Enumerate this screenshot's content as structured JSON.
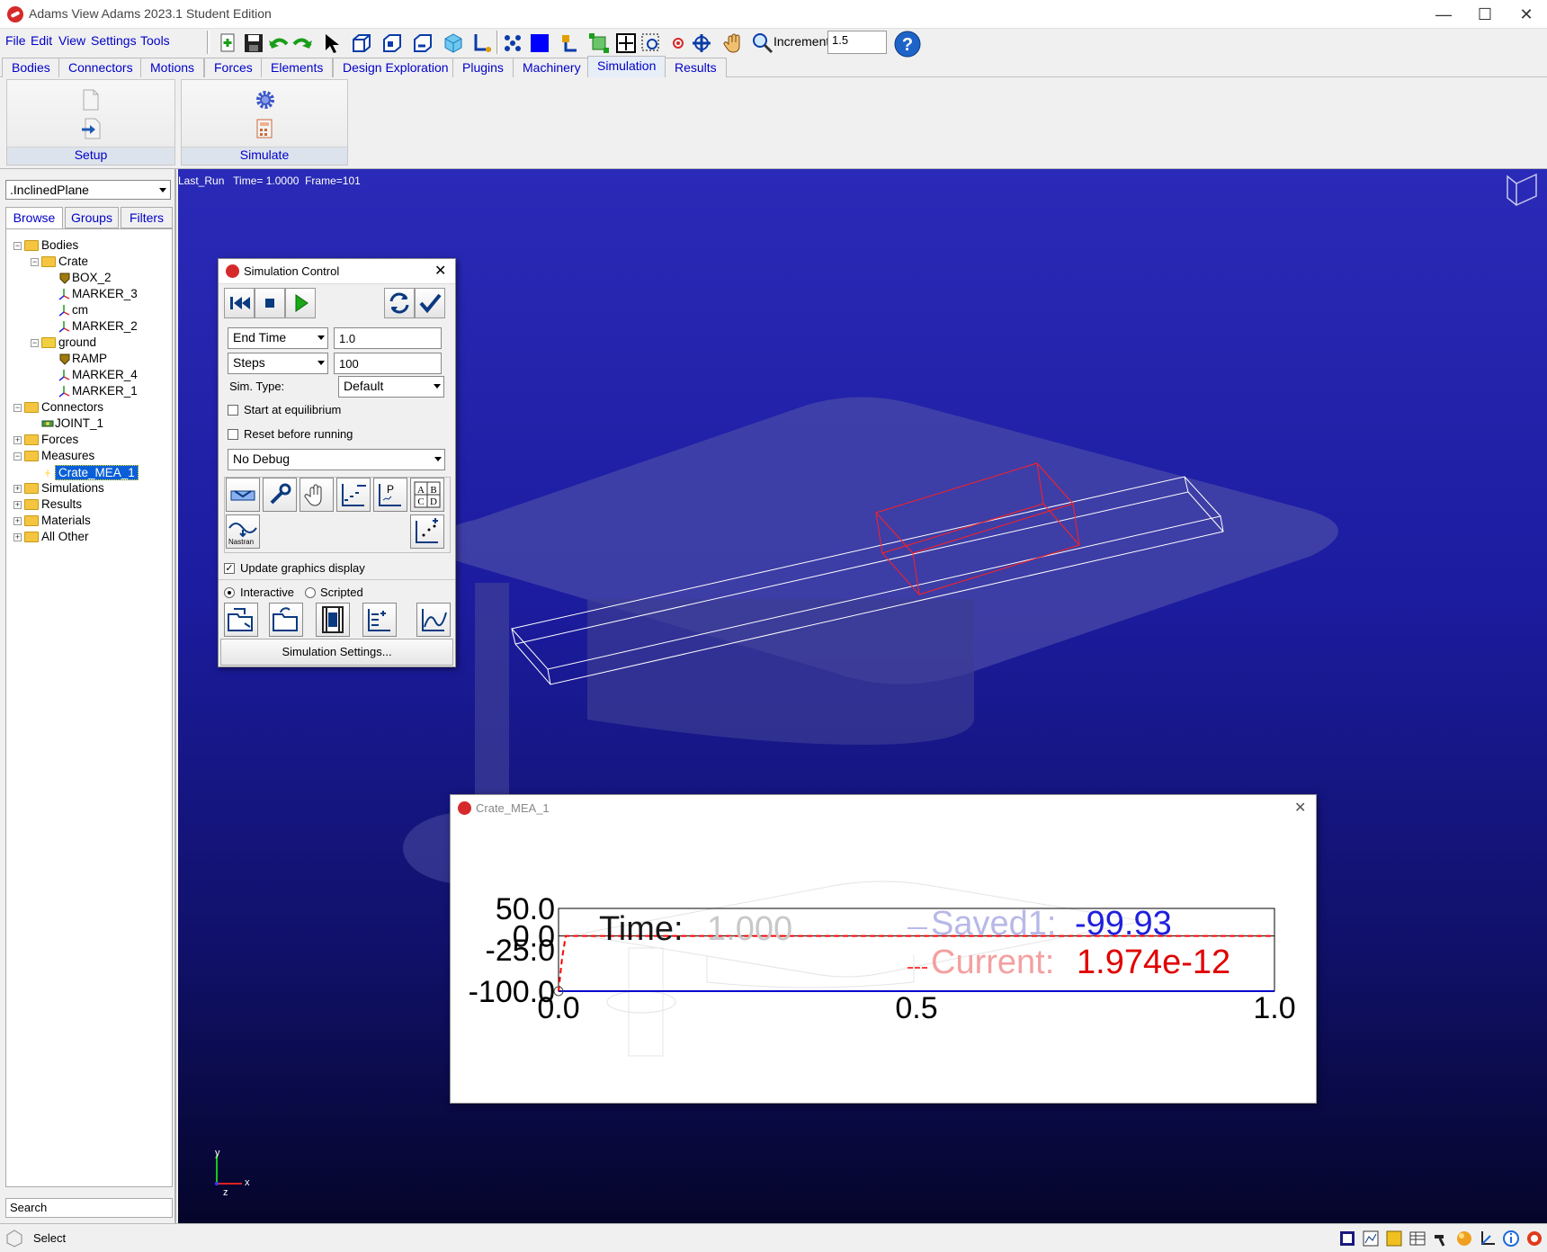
{
  "window": {
    "title": "Adams  View Adams 2023.1 Student Edition",
    "controls": [
      "—",
      "☐",
      "✕"
    ]
  },
  "menu": [
    "File",
    "Edit",
    "View",
    "Settings",
    "Tools"
  ],
  "toolbar": {
    "icons": [
      "new-icon",
      "save-icon",
      "undo-icon",
      "redo-icon",
      "select-arrow-icon",
      "iso-view-icon",
      "front-view-icon",
      "side-view-icon",
      "render-cube-icon",
      "axes-icon",
      "grid-icon",
      "color-square-icon",
      "orient-icon",
      "fit-icon",
      "zoom-box-icon",
      "zoom-window-icon",
      "center-icon",
      "rotate-icon",
      "pan-hand-icon",
      "zoom-icon",
      "help-icon"
    ],
    "increment_label": "Increment",
    "increment_value": "1.5"
  },
  "tabs": [
    "Bodies",
    "Connectors",
    "Motions",
    "Forces",
    "Elements",
    "Design Exploration",
    "Plugins",
    "Machinery",
    "Simulation",
    "Results"
  ],
  "active_tab": "Simulation",
  "ribbon": {
    "groups": [
      "Setup",
      "Simulate"
    ]
  },
  "left_panel": {
    "model": ".InclinedPlane",
    "tabs": [
      "Browse",
      "Groups",
      "Filters"
    ],
    "active_tab": "Browse",
    "tree": [
      {
        "label": "Bodies",
        "level": 0,
        "type": "folder",
        "exp": "−"
      },
      {
        "label": "Crate",
        "level": 1,
        "type": "folder",
        "exp": "−"
      },
      {
        "label": "BOX_2",
        "level": 2,
        "type": "solid"
      },
      {
        "label": "MARKER_3",
        "level": 2,
        "type": "marker"
      },
      {
        "label": "cm",
        "level": 2,
        "type": "marker"
      },
      {
        "label": "MARKER_2",
        "level": 2,
        "type": "marker"
      },
      {
        "label": "ground",
        "level": 1,
        "type": "ground",
        "exp": "−"
      },
      {
        "label": "RAMP",
        "level": 2,
        "type": "solid"
      },
      {
        "label": "MARKER_4",
        "level": 2,
        "type": "marker"
      },
      {
        "label": "MARKER_1",
        "level": 2,
        "type": "marker"
      },
      {
        "label": "Connectors",
        "level": 0,
        "type": "folder",
        "exp": "−"
      },
      {
        "label": "JOINT_1",
        "level": 1,
        "type": "joint"
      },
      {
        "label": "Forces",
        "level": 0,
        "type": "folder",
        "exp": "+"
      },
      {
        "label": "Measures",
        "level": 0,
        "type": "folder",
        "exp": "−"
      },
      {
        "label": "Crate_MEA_1",
        "level": 1,
        "type": "measure",
        "selected": true
      },
      {
        "label": "Simulations",
        "level": 0,
        "type": "folder",
        "exp": "+"
      },
      {
        "label": "Results",
        "level": 0,
        "type": "folder",
        "exp": "+"
      },
      {
        "label": "Materials",
        "level": 0,
        "type": "folder",
        "exp": "+"
      },
      {
        "label": "All Other",
        "level": 0,
        "type": "folder",
        "exp": "+"
      }
    ],
    "search_placeholder": "Search"
  },
  "viewport": {
    "status": "Last_Run   Time= 1.0000  Frame=101",
    "triad": {
      "y": "y",
      "x": "x",
      "z": "z"
    }
  },
  "sim_control": {
    "title": "Simulation Control",
    "end_time_mode": "End Time",
    "end_time_value": "1.0",
    "steps_mode": "Steps",
    "steps_value": "100",
    "sim_type_label": "Sim. Type:",
    "sim_type_value": "Default",
    "start_equilibrium_label": "Start at equilibrium",
    "start_equilibrium_checked": false,
    "reset_label": "Reset before running",
    "reset_checked": false,
    "debug_value": "No Debug",
    "update_graphics_label": "Update graphics display",
    "update_graphics_checked": true,
    "interactive_label": "Interactive",
    "scripted_label": "Scripted",
    "mode": "Interactive",
    "nastran_label": "Nastran",
    "settings_button": "Simulation Settings..."
  },
  "plot_window": {
    "title": "Crate_MEA_1",
    "time_label": "Time:",
    "time_value": "1.000",
    "saved_label": "Saved1:",
    "saved_value": "-99.93",
    "current_label": "Current:",
    "current_value": "1.974e-12",
    "colors": {
      "saved": "#0000cc",
      "current": "#ff0000",
      "label_fade": "#b8b8e8"
    }
  },
  "chart_data": {
    "type": "line",
    "title": "",
    "xlabel": "",
    "ylabel": "",
    "xlim": [
      0.0,
      1.0
    ],
    "ylim": [
      -100.0,
      50.0
    ],
    "x_ticks": [
      "0.0",
      "0.5",
      "1.0"
    ],
    "y_ticks": [
      "50.0",
      "0.0",
      "-25.0",
      "-100.0"
    ],
    "series": [
      {
        "name": "Saved1",
        "x": [
          0.0,
          1.0
        ],
        "y": [
          -100.0,
          -100.0
        ],
        "color": "#0000cc",
        "style": "solid"
      },
      {
        "name": "Current",
        "x": [
          0.0,
          0.005,
          0.01,
          1.0
        ],
        "y": [
          -100.0,
          -40.0,
          0.0,
          0.0
        ],
        "color": "#ff0000",
        "style": "dashed"
      }
    ]
  },
  "status_bar": {
    "label": "Select"
  }
}
